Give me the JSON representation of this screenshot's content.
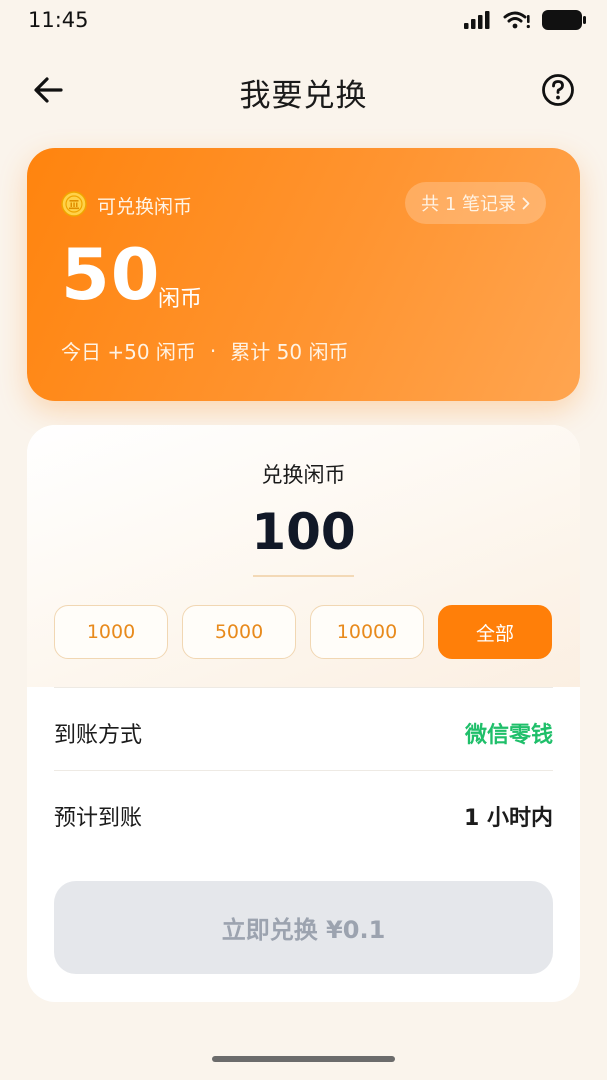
{
  "status_bar": {
    "time": "11:45"
  },
  "header": {
    "title": "我要兑换"
  },
  "balance": {
    "label": "可兑换闲币",
    "records": "共 1 笔记录",
    "amount": "50",
    "unit": "闲币",
    "today": "今日 +50 闲币",
    "separator": "·",
    "total": "累计 50 闲币"
  },
  "exchange": {
    "label": "兑换闲币",
    "amount": "100",
    "options": [
      {
        "label": "1000",
        "active": false
      },
      {
        "label": "5000",
        "active": false
      },
      {
        "label": "10000",
        "active": false
      },
      {
        "label": "全部",
        "active": true
      }
    ],
    "method_label": "到账方式",
    "method_value": "微信零钱",
    "eta_label": "预计到账",
    "eta_value": "1 小时内",
    "submit_label": "立即兑换 ¥0.1"
  },
  "colors": {
    "accent": "#ff7f09",
    "success": "#1fbf6a",
    "disabled_bg": "#e5e7eb",
    "disabled_text": "#9ca3af"
  },
  "icons": {
    "back": "arrow-left-icon",
    "help": "question-circle-icon",
    "coin": "coin-icon",
    "chevron": "chevron-right-icon"
  }
}
